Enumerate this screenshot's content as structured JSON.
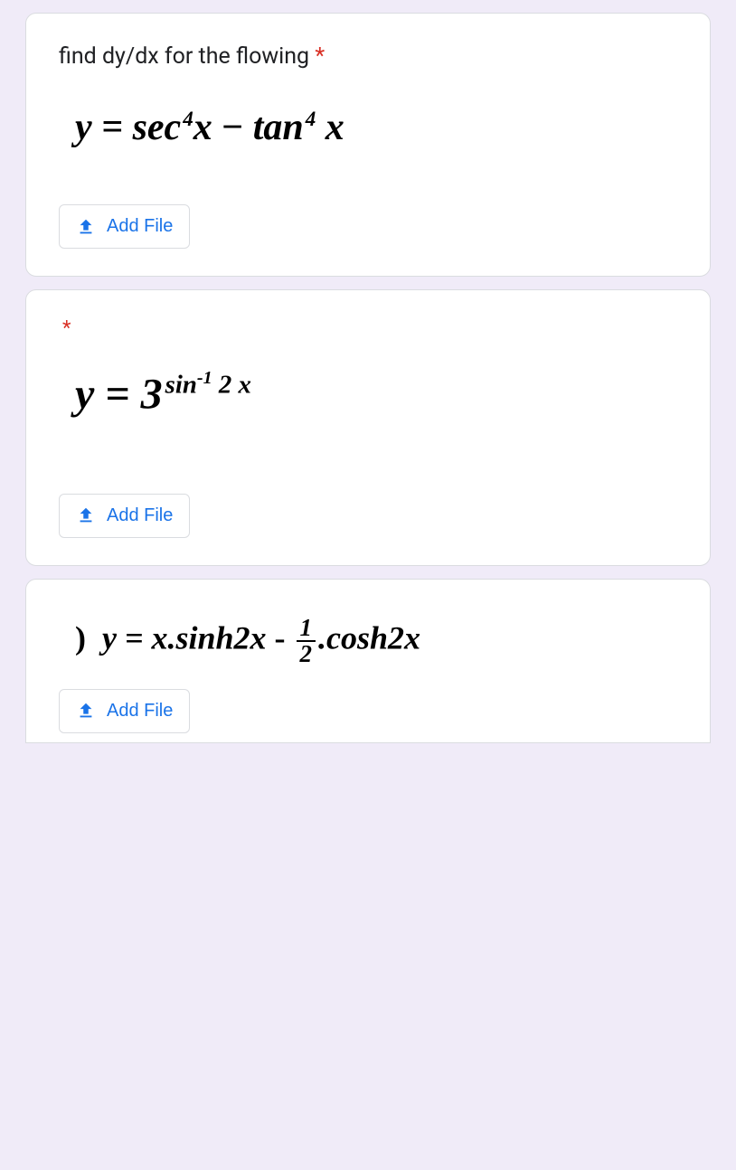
{
  "buttons": {
    "add_file_label": "Add File"
  },
  "questions": [
    {
      "title": "find dy/dx for the flowing",
      "required": true,
      "equation_text": "y = sec⁴x − tan⁴ x"
    },
    {
      "title": "",
      "required": true,
      "equation_text": "y = 3^(sin⁻¹ 2x)"
    },
    {
      "title": "",
      "required": false,
      "equation_text": ") y = x.sinh2x - (1/2).cosh2x"
    }
  ]
}
